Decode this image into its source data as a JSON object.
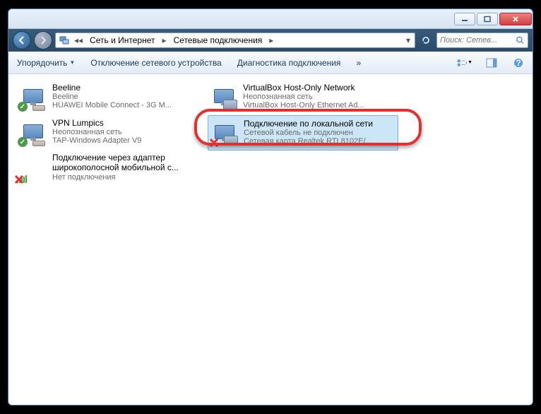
{
  "breadcrumb": {
    "seg1": "Сеть и Интернет",
    "seg2": "Сетевые подключения"
  },
  "search": {
    "placeholder": "Поиск: Сетев..."
  },
  "toolbar": {
    "organize": "Упорядочить",
    "disable": "Отключение сетевого устройства",
    "diagnose": "Диагностика подключения",
    "more": "»"
  },
  "items": [
    {
      "name": "Beeline",
      "line2": "Beeline",
      "line3": "HUAWEI Mobile Connect - 3G M...",
      "icon": "modem",
      "badge": "ok"
    },
    {
      "name": "VirtualBox Host-Only Network",
      "line2": "Неопознанная сеть",
      "line3": "VirtualBox Host-Only Ethernet Ad...",
      "icon": "dual",
      "badge": ""
    },
    {
      "name": "VPN Lumpics",
      "line2": "Неопознанная сеть",
      "line3": "TAP-Windows Adapter V9",
      "icon": "modem",
      "badge": "ok"
    },
    {
      "name": "Подключение по локальной сети",
      "line2": "Сетевой кабель не подключен",
      "line3": "Сетевая карта Realtek RTL8102E/...",
      "icon": "dual",
      "badge": "x",
      "selected": true
    },
    {
      "name": "Подключение через адаптер широкополосной мобильной с...",
      "line2": "Нет подключения",
      "line3": "",
      "icon": "signal",
      "badge": "x"
    }
  ]
}
